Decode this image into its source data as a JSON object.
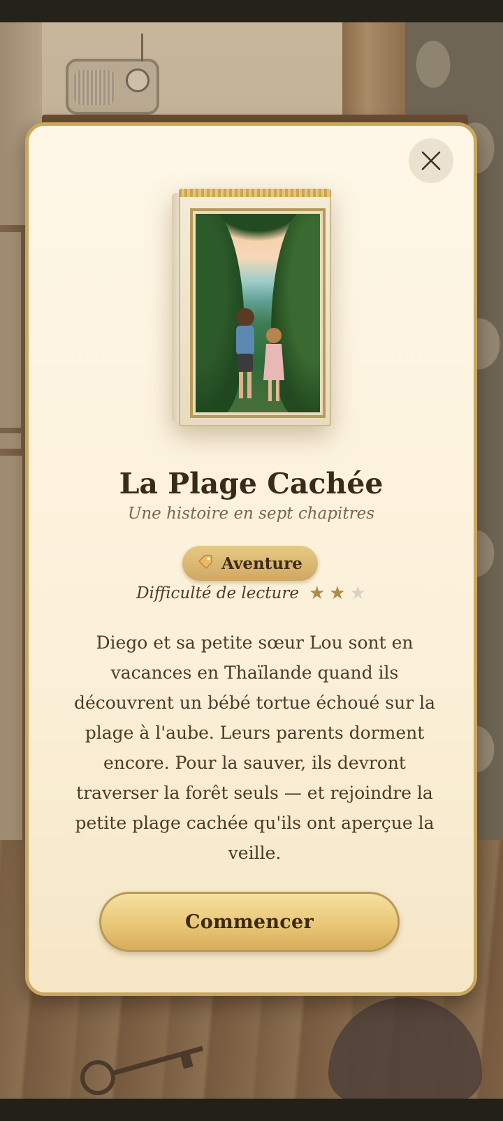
{
  "story": {
    "title": "La Plage Cachée",
    "subtitle": "Une histoire en sept chapitres",
    "genre": {
      "icon": "tag-icon",
      "label": "Aventure"
    },
    "difficulty": {
      "label": "Difficulté de lecture",
      "rating": 2,
      "max": 3
    },
    "description": "Diego et sa petite sœur Lou sont en vacances en Thaïlande quand ils découvrent un bébé tortue échoué sur la plage à l'aube. Leurs parents dorment encore. Pour la sauver, ils devront traverser la forêt seuls — et rejoindre la petite plage cachée qu'ils ont aperçue la veille.",
    "start_label": "Commencer"
  },
  "dialog": {
    "close_icon": "close-icon"
  },
  "colors": {
    "accent": "#d7ad5a",
    "modal_bg": "#fdf5e3",
    "border": "#c9a75e",
    "text": "#3a2a1a"
  }
}
